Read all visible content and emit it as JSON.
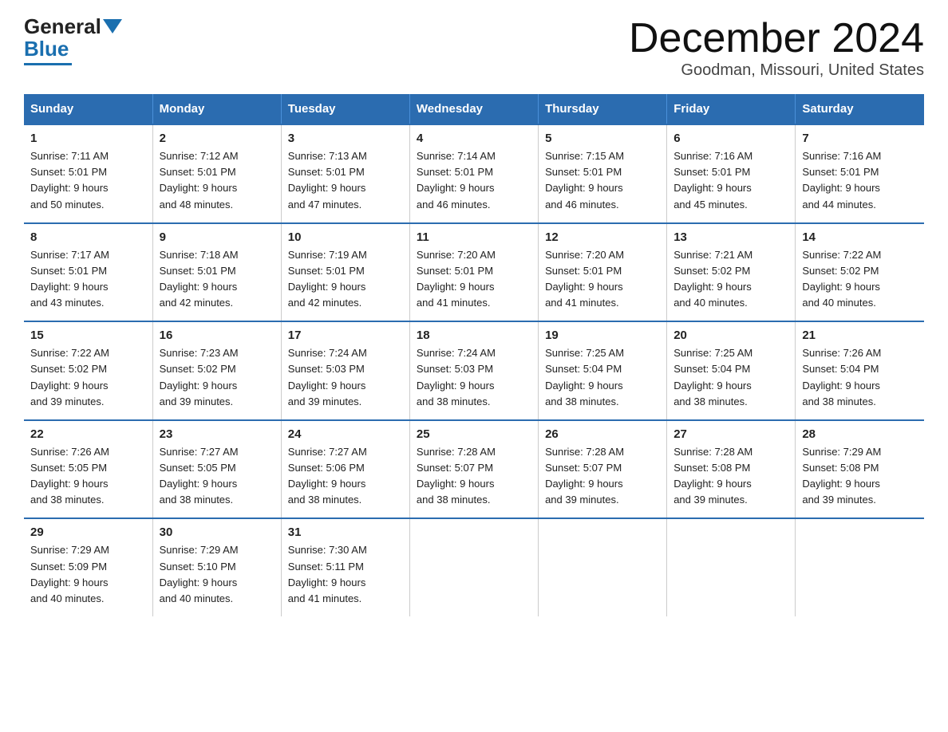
{
  "header": {
    "logo_general": "General",
    "logo_blue": "Blue",
    "title": "December 2024",
    "subtitle": "Goodman, Missouri, United States"
  },
  "columns": [
    "Sunday",
    "Monday",
    "Tuesday",
    "Wednesday",
    "Thursday",
    "Friday",
    "Saturday"
  ],
  "weeks": [
    [
      {
        "day": "1",
        "sunrise": "7:11 AM",
        "sunset": "5:01 PM",
        "daylight": "9 hours and 50 minutes."
      },
      {
        "day": "2",
        "sunrise": "7:12 AM",
        "sunset": "5:01 PM",
        "daylight": "9 hours and 48 minutes."
      },
      {
        "day": "3",
        "sunrise": "7:13 AM",
        "sunset": "5:01 PM",
        "daylight": "9 hours and 47 minutes."
      },
      {
        "day": "4",
        "sunrise": "7:14 AM",
        "sunset": "5:01 PM",
        "daylight": "9 hours and 46 minutes."
      },
      {
        "day": "5",
        "sunrise": "7:15 AM",
        "sunset": "5:01 PM",
        "daylight": "9 hours and 46 minutes."
      },
      {
        "day": "6",
        "sunrise": "7:16 AM",
        "sunset": "5:01 PM",
        "daylight": "9 hours and 45 minutes."
      },
      {
        "day": "7",
        "sunrise": "7:16 AM",
        "sunset": "5:01 PM",
        "daylight": "9 hours and 44 minutes."
      }
    ],
    [
      {
        "day": "8",
        "sunrise": "7:17 AM",
        "sunset": "5:01 PM",
        "daylight": "9 hours and 43 minutes."
      },
      {
        "day": "9",
        "sunrise": "7:18 AM",
        "sunset": "5:01 PM",
        "daylight": "9 hours and 42 minutes."
      },
      {
        "day": "10",
        "sunrise": "7:19 AM",
        "sunset": "5:01 PM",
        "daylight": "9 hours and 42 minutes."
      },
      {
        "day": "11",
        "sunrise": "7:20 AM",
        "sunset": "5:01 PM",
        "daylight": "9 hours and 41 minutes."
      },
      {
        "day": "12",
        "sunrise": "7:20 AM",
        "sunset": "5:01 PM",
        "daylight": "9 hours and 41 minutes."
      },
      {
        "day": "13",
        "sunrise": "7:21 AM",
        "sunset": "5:02 PM",
        "daylight": "9 hours and 40 minutes."
      },
      {
        "day": "14",
        "sunrise": "7:22 AM",
        "sunset": "5:02 PM",
        "daylight": "9 hours and 40 minutes."
      }
    ],
    [
      {
        "day": "15",
        "sunrise": "7:22 AM",
        "sunset": "5:02 PM",
        "daylight": "9 hours and 39 minutes."
      },
      {
        "day": "16",
        "sunrise": "7:23 AM",
        "sunset": "5:02 PM",
        "daylight": "9 hours and 39 minutes."
      },
      {
        "day": "17",
        "sunrise": "7:24 AM",
        "sunset": "5:03 PM",
        "daylight": "9 hours and 39 minutes."
      },
      {
        "day": "18",
        "sunrise": "7:24 AM",
        "sunset": "5:03 PM",
        "daylight": "9 hours and 38 minutes."
      },
      {
        "day": "19",
        "sunrise": "7:25 AM",
        "sunset": "5:04 PM",
        "daylight": "9 hours and 38 minutes."
      },
      {
        "day": "20",
        "sunrise": "7:25 AM",
        "sunset": "5:04 PM",
        "daylight": "9 hours and 38 minutes."
      },
      {
        "day": "21",
        "sunrise": "7:26 AM",
        "sunset": "5:04 PM",
        "daylight": "9 hours and 38 minutes."
      }
    ],
    [
      {
        "day": "22",
        "sunrise": "7:26 AM",
        "sunset": "5:05 PM",
        "daylight": "9 hours and 38 minutes."
      },
      {
        "day": "23",
        "sunrise": "7:27 AM",
        "sunset": "5:05 PM",
        "daylight": "9 hours and 38 minutes."
      },
      {
        "day": "24",
        "sunrise": "7:27 AM",
        "sunset": "5:06 PM",
        "daylight": "9 hours and 38 minutes."
      },
      {
        "day": "25",
        "sunrise": "7:28 AM",
        "sunset": "5:07 PM",
        "daylight": "9 hours and 38 minutes."
      },
      {
        "day": "26",
        "sunrise": "7:28 AM",
        "sunset": "5:07 PM",
        "daylight": "9 hours and 39 minutes."
      },
      {
        "day": "27",
        "sunrise": "7:28 AM",
        "sunset": "5:08 PM",
        "daylight": "9 hours and 39 minutes."
      },
      {
        "day": "28",
        "sunrise": "7:29 AM",
        "sunset": "5:08 PM",
        "daylight": "9 hours and 39 minutes."
      }
    ],
    [
      {
        "day": "29",
        "sunrise": "7:29 AM",
        "sunset": "5:09 PM",
        "daylight": "9 hours and 40 minutes."
      },
      {
        "day": "30",
        "sunrise": "7:29 AM",
        "sunset": "5:10 PM",
        "daylight": "9 hours and 40 minutes."
      },
      {
        "day": "31",
        "sunrise": "7:30 AM",
        "sunset": "5:11 PM",
        "daylight": "9 hours and 41 minutes."
      },
      null,
      null,
      null,
      null
    ]
  ],
  "labels": {
    "sunrise": "Sunrise:",
    "sunset": "Sunset:",
    "daylight": "Daylight:"
  }
}
